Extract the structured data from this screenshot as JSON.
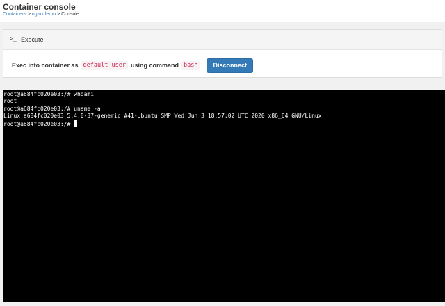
{
  "header": {
    "title": "Container console",
    "breadcrumb": {
      "items": [
        "Containers",
        "nginxdemo"
      ],
      "current": "Console",
      "separator": ">"
    }
  },
  "panel": {
    "icon": "terminal-icon",
    "icon_glyph": ">_",
    "title": "Execute",
    "exec_prefix": "Exec into container as",
    "user": "default user",
    "exec_middle": "using command",
    "command": "bash",
    "disconnect_label": "Disconnect"
  },
  "terminal": {
    "lines": [
      "root@a684fc020e03:/# whoami",
      "root",
      "root@a684fc020e03:/# uname -a",
      "Linux a684fc020e03 5.4.0-37-generic #41-Ubuntu SMP Wed Jun 3 18:57:02 UTC 2020 x86_64 GNU/Linux",
      "root@a684fc020e03:/# "
    ]
  },
  "colors": {
    "accent": "#337ab7",
    "code_text": "#c7254e",
    "terminal_bg": "#000000"
  }
}
